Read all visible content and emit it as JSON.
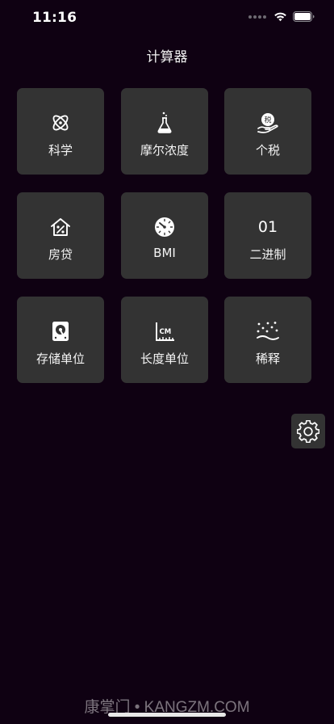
{
  "status_bar": {
    "time": "11:16"
  },
  "header": {
    "title": "计算器"
  },
  "tiles": [
    {
      "label": "科学",
      "icon": "atom-icon"
    },
    {
      "label": "摩尔浓度",
      "icon": "flask-icon"
    },
    {
      "label": "个税",
      "icon": "tax-hand-icon",
      "icon_text": "税"
    },
    {
      "label": "房贷",
      "icon": "house-percent-icon"
    },
    {
      "label": "BMI",
      "icon": "scale-dial-icon"
    },
    {
      "label": "二进制",
      "icon": "binary-icon",
      "icon_text": "01"
    },
    {
      "label": "存储单位",
      "icon": "hard-drive-icon"
    },
    {
      "label": "长度单位",
      "icon": "ruler-cm-icon",
      "icon_text": "CM"
    },
    {
      "label": "稀释",
      "icon": "dilution-dots-icon"
    }
  ],
  "settings": {
    "icon": "gear-icon"
  },
  "watermark": {
    "text": "康掌门 • KANGZM.COM"
  },
  "colors": {
    "background": "#0f0112",
    "tile": "#333333",
    "text": "#ffffff"
  }
}
